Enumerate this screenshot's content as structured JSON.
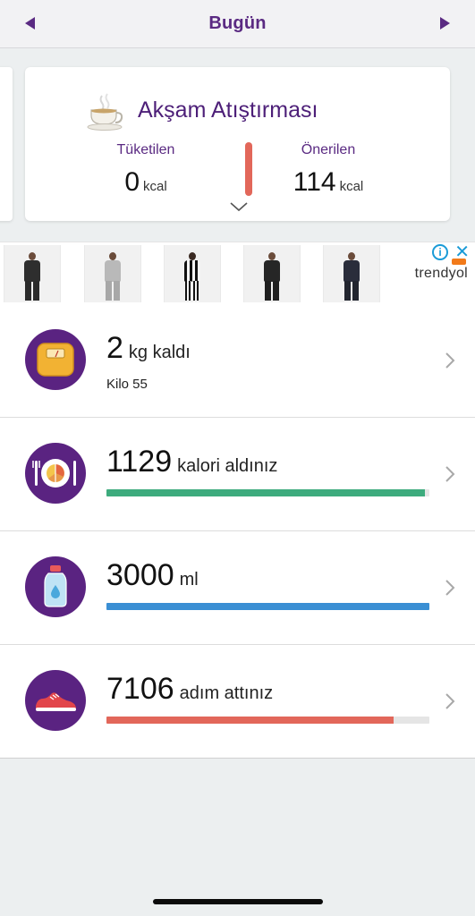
{
  "header": {
    "title": "Bugün",
    "prev_icon": "triangle-left-icon",
    "next_icon": "triangle-right-icon"
  },
  "meal": {
    "title": "Akşam Atıştırması",
    "icon": "teacup-icon",
    "consumed_label": "Tüketilen",
    "consumed_value": "0",
    "consumed_unit": "kcal",
    "recommended_label": "Önerilen",
    "recommended_value": "114",
    "recommended_unit": "kcal",
    "gauge_color": "#e2675a",
    "expand_icon": "chevron-down-icon"
  },
  "ad": {
    "brand": "trendyol",
    "info_icon": "info-icon",
    "close_icon": "close-icon",
    "thumbnail_count": 5
  },
  "summary": [
    {
      "icon": "scale-icon",
      "value": "2",
      "unit_text": "kg kaldı",
      "subtitle": "Kilo 55"
    },
    {
      "icon": "plate-cutlery-icon",
      "value": "1129",
      "unit_text": "kalori aldınız",
      "progress": 0.985,
      "color": "#3dab7d"
    },
    {
      "icon": "water-bottle-icon",
      "value": "3000",
      "unit_text": "ml",
      "progress": 1.0,
      "color": "#3a8fd4"
    },
    {
      "icon": "sneaker-icon",
      "value": "7106",
      "unit_text": "adım attınız",
      "progress": 0.89,
      "color": "#e2675a"
    }
  ],
  "colors": {
    "brand_purple": "#5a2a82",
    "icon_circle": "#5a2381"
  }
}
